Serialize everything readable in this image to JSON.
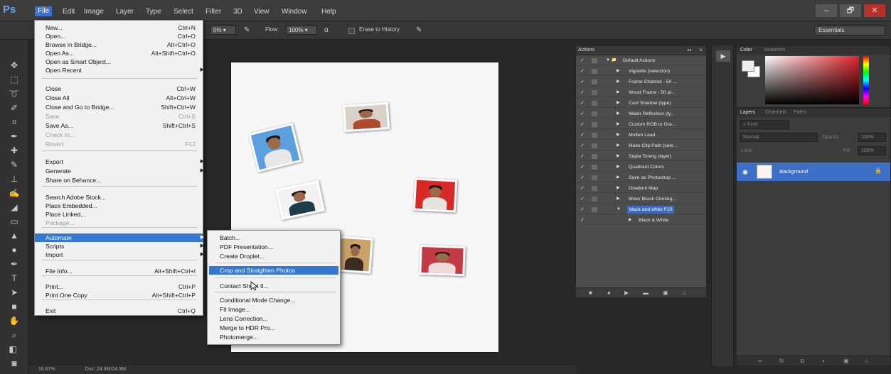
{
  "app": {
    "logo": "Ps"
  },
  "menubar": {
    "items": [
      "File",
      "Edit",
      "Image",
      "Layer",
      "Type",
      "Select",
      "Filter",
      "3D",
      "View",
      "Window",
      "Help"
    ],
    "window_controls": [
      "–",
      "🗗",
      "✕"
    ]
  },
  "options": {
    "opacity_value": "0%",
    "flow_label": "Flow:",
    "flow_value": "100%",
    "erase_history": "Erase to History",
    "workspace": "Essentials"
  },
  "file_menu": {
    "items": [
      {
        "label": "New...",
        "shortcut": "Ctrl+N",
        "state": "normal"
      },
      {
        "label": "Open...",
        "shortcut": "Ctrl+O",
        "state": "normal"
      },
      {
        "label": "Browse in Bridge...",
        "shortcut": "Alt+Ctrl+O",
        "state": "normal"
      },
      {
        "label": "Open As...",
        "shortcut": "Alt+Shift+Ctrl+O",
        "state": "normal"
      },
      {
        "label": "Open as Smart Object...",
        "shortcut": "",
        "state": "normal"
      },
      {
        "label": "Open Recent",
        "shortcut": "",
        "state": "submenu"
      },
      {
        "label": "Close",
        "shortcut": "Ctrl+W",
        "state": "normal"
      },
      {
        "label": "Close All",
        "shortcut": "Alt+Ctrl+W",
        "state": "normal"
      },
      {
        "label": "Close and Go to Bridge...",
        "shortcut": "Shift+Ctrl+W",
        "state": "normal"
      },
      {
        "label": "Save",
        "shortcut": "Ctrl+S",
        "state": "disabled"
      },
      {
        "label": "Save As...",
        "shortcut": "Shift+Ctrl+S",
        "state": "normal"
      },
      {
        "label": "Check In...",
        "shortcut": "",
        "state": "disabled"
      },
      {
        "label": "Revert",
        "shortcut": "F12",
        "state": "disabled"
      },
      {
        "label": "Export",
        "shortcut": "",
        "state": "submenu"
      },
      {
        "label": "Generate",
        "shortcut": "",
        "state": "submenu"
      },
      {
        "label": "Share on Behance...",
        "shortcut": "",
        "state": "normal"
      },
      {
        "label": "Search Adobe Stock...",
        "shortcut": "",
        "state": "normal"
      },
      {
        "label": "Place Embedded...",
        "shortcut": "",
        "state": "normal"
      },
      {
        "label": "Place Linked...",
        "shortcut": "",
        "state": "normal"
      },
      {
        "label": "Package...",
        "shortcut": "",
        "state": "disabled"
      },
      {
        "label": "Automate",
        "shortcut": "",
        "state": "highlight"
      },
      {
        "label": "Scripts",
        "shortcut": "",
        "state": "submenu"
      },
      {
        "label": "Import",
        "shortcut": "",
        "state": "submenu"
      },
      {
        "label": "File Info...",
        "shortcut": "Alt+Shift+Ctrl+I",
        "state": "normal"
      },
      {
        "label": "Print...",
        "shortcut": "Ctrl+P",
        "state": "normal"
      },
      {
        "label": "Print One Copy",
        "shortcut": "Alt+Shift+Ctrl+P",
        "state": "normal"
      },
      {
        "label": "Exit",
        "shortcut": "Ctrl+Q",
        "state": "normal"
      }
    ]
  },
  "automate_menu": {
    "items": [
      {
        "label": "Batch...",
        "state": "normal"
      },
      {
        "label": "PDF Presentation...",
        "state": "normal"
      },
      {
        "label": "Create Droplet...",
        "state": "normal"
      },
      {
        "label": "Crop and Straighten Photos",
        "state": "highlight"
      },
      {
        "label": "Contact Sheet II...",
        "state": "normal"
      },
      {
        "label": "Conditional Mode Change...",
        "state": "normal"
      },
      {
        "label": "Fit Image...",
        "state": "normal"
      },
      {
        "label": "Lens Correction...",
        "state": "normal"
      },
      {
        "label": "Merge to HDR Pro...",
        "state": "normal"
      },
      {
        "label": "Photomerge...",
        "state": "normal"
      }
    ]
  },
  "actions_panel": {
    "tab": "Actions",
    "rows": [
      {
        "label": "Default Actions",
        "type": "set",
        "selected": false
      },
      {
        "label": "Vignette (selection)",
        "type": "action",
        "selected": false
      },
      {
        "label": "Frame Channel - 50 ...",
        "type": "action",
        "selected": false
      },
      {
        "label": "Wood Frame - 50 pi...",
        "type": "action",
        "selected": false
      },
      {
        "label": "Cast Shadow (type)",
        "type": "action",
        "selected": false
      },
      {
        "label": "Water Reflection (ty...",
        "type": "action",
        "selected": false
      },
      {
        "label": "Custom RGB to Gra...",
        "type": "action",
        "selected": false
      },
      {
        "label": "Molten Lead",
        "type": "action",
        "selected": false
      },
      {
        "label": "Make Clip Path (sele...",
        "type": "action",
        "selected": false
      },
      {
        "label": "Sepia Toning (layer)",
        "type": "action",
        "selected": false
      },
      {
        "label": "Quadrant Colors",
        "type": "action",
        "selected": false
      },
      {
        "label": "Save as Photoshop ...",
        "type": "action",
        "selected": false
      },
      {
        "label": "Gradient Map",
        "type": "action",
        "selected": false
      },
      {
        "label": "Mixer Brush Cloning...",
        "type": "action",
        "selected": false
      },
      {
        "label": "black and white   F10",
        "type": "action-open",
        "selected": true
      },
      {
        "label": "Black & White",
        "type": "step",
        "selected": false
      }
    ]
  },
  "color_panel": {
    "tabs": [
      "Color",
      "Swatches"
    ]
  },
  "layers_panel": {
    "tabs": [
      "Layers",
      "Channels",
      "Paths"
    ],
    "kind_filter": "Kind",
    "blend_mode": "Normal",
    "opacity_label": "Opacity:",
    "opacity_value": "100%",
    "lock_label": "Lock:",
    "fill_label": "Fill:",
    "fill_value": "100%",
    "layer_name": "Background"
  },
  "statusbar": {
    "zoom": "16.67%",
    "doc_info": "Doc: 24.9M/24.9M"
  },
  "colors": {
    "accent": "#3478d0",
    "menubar": "#3c3c3c",
    "panel": "#4c4c4c"
  }
}
